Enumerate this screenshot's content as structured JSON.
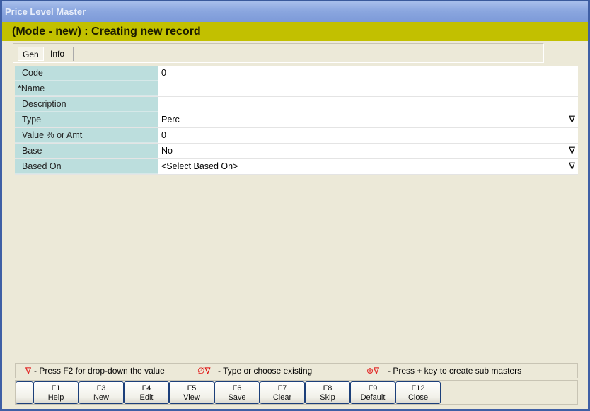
{
  "window": {
    "title": "Price Level Master"
  },
  "mode_banner": "(Mode - new) : Creating new record",
  "tabs": [
    {
      "label": "Gen",
      "active": true
    },
    {
      "label": "Info",
      "active": false
    }
  ],
  "fields": [
    {
      "label": "Code",
      "value": "0",
      "dropdown": false
    },
    {
      "label": "*Name",
      "value": "",
      "dropdown": false
    },
    {
      "label": "Description",
      "value": "",
      "dropdown": false
    },
    {
      "label": "Type",
      "value": "Perc",
      "dropdown": true
    },
    {
      "label": "Value % or Amt",
      "value": "0",
      "dropdown": false
    },
    {
      "label": "Base",
      "value": "No",
      "dropdown": true
    },
    {
      "label": "Based On",
      "value": "<Select Based On>",
      "dropdown": true
    }
  ],
  "dropdown_glyph": "∇",
  "legend": {
    "dropdown_icon": "∇",
    "dropdown_text": "- Press F2 for drop-down the value",
    "type_icon": "∅∇",
    "type_text": "- Type or choose existing",
    "sub_icon": "⊕∇",
    "sub_text": "- Press + key to create sub masters"
  },
  "buttons": [
    {
      "key": "F1",
      "label": "Help"
    },
    {
      "key": "F3",
      "label": "New"
    },
    {
      "key": "F4",
      "label": "Edit"
    },
    {
      "key": "F5",
      "label": "View"
    },
    {
      "key": "F6",
      "label": "Save"
    },
    {
      "key": "F7",
      "label": "Clear"
    },
    {
      "key": "F8",
      "label": "Skip"
    },
    {
      "key": "F9",
      "label": "Default"
    },
    {
      "key": "F12",
      "label": "Close"
    }
  ]
}
